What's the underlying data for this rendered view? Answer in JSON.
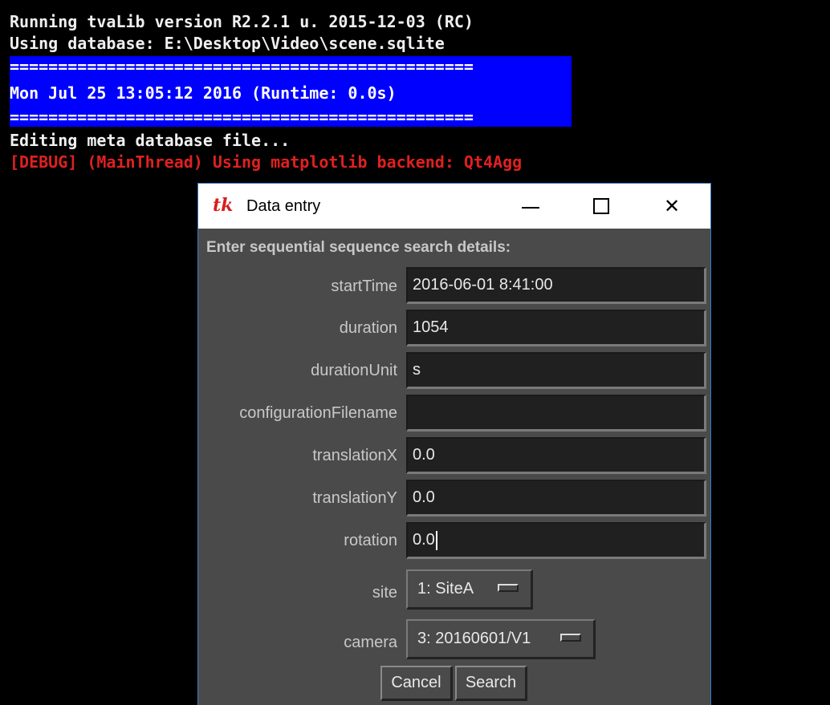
{
  "console": {
    "line1": "Running tvaLib version R2.2.1 u. 2015-12-03 (RC)",
    "line2": "Using database: E:\\Desktop\\Video\\scene.sqlite",
    "separator": "================================================",
    "line3": "Mon Jul 25 13:05:12 2016 (Runtime: 0.0s)",
    "line4": "Editing meta database file...",
    "debug": "[DEBUG] (MainThread) Using matplotlib backend: Qt4Agg"
  },
  "dialog": {
    "title": "Data entry",
    "app_icon": "tk",
    "minimize_icon": "minimize-icon",
    "maximize_icon": "maximize-icon",
    "close_icon": "close-icon",
    "close_glyph": "✕",
    "prompt": "Enter sequential sequence search details:",
    "fields": [
      {
        "label": "startTime",
        "value": "2016-06-01 8:41:00"
      },
      {
        "label": "duration",
        "value": "1054"
      },
      {
        "label": "durationUnit",
        "value": "s"
      },
      {
        "label": "configurationFilename",
        "value": ""
      },
      {
        "label": "translationX",
        "value": "0.0"
      },
      {
        "label": "translationY",
        "value": "0.0"
      },
      {
        "label": "rotation",
        "value": "0.0"
      }
    ],
    "site": {
      "label": "site",
      "value": "1: SiteA"
    },
    "camera": {
      "label": "camera",
      "value": "3: 20160601/V1"
    },
    "cancel_label": "Cancel",
    "search_label": "Search"
  },
  "colors": {
    "console_bg": "#000000",
    "highlight": "#0000ff",
    "debug": "#e02020",
    "dialog_bg": "#4a4a4a",
    "field_bg": "#202020"
  }
}
